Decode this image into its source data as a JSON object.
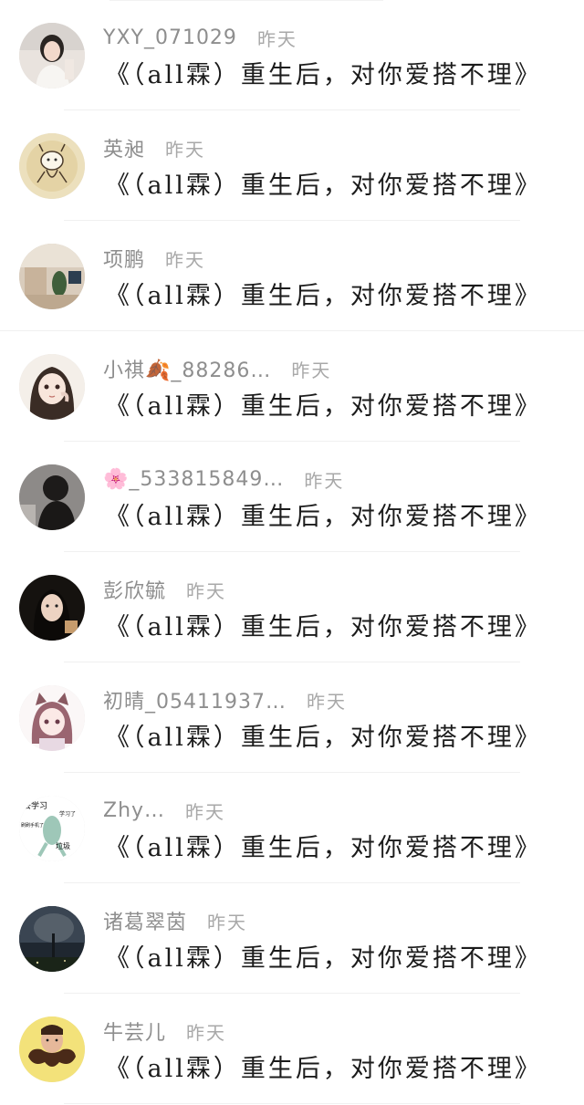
{
  "comments": [
    {
      "name": "YXY_071029",
      "time": "昨天",
      "title": "《（all霖）重生后，对你爱搭不理》",
      "avatar": "avatar-girl-photo"
    },
    {
      "name": "英昶",
      "time": "昨天",
      "title": "《（all霖）重生后，对你爱搭不理》",
      "avatar": "avatar-cartoon-creature"
    },
    {
      "name": "项鹏",
      "time": "昨天",
      "title": "《（all霖）重生后，对你爱搭不理》",
      "avatar": "avatar-room-photo"
    },
    {
      "name": "小祺🍂_88286…",
      "time": "昨天",
      "title": "《（all霖）重生后，对你爱搭不理》",
      "avatar": "avatar-anime-girl"
    },
    {
      "name": "🌸_533815849…",
      "time": "昨天",
      "title": "《（all霖）重生后，对你爱搭不理》",
      "avatar": "avatar-dark-silhouette"
    },
    {
      "name": "彭欣毓",
      "time": "昨天",
      "title": "《（all霖）重生后，对你爱搭不理》",
      "avatar": "avatar-girl-dark-photo"
    },
    {
      "name": "初晴_05411937…",
      "time": "昨天",
      "title": "《（all霖）重生后，对你爱搭不理》",
      "avatar": "avatar-catgirl-anime"
    },
    {
      "name": "Zhy…",
      "time": "昨天",
      "title": "《（all霖）重生后，对你爱搭不理》",
      "avatar": "avatar-meme-squidward"
    },
    {
      "name": "诸葛翠茵",
      "time": "昨天",
      "title": "《（all霖）重生后，对你爱搭不理》",
      "avatar": "avatar-night-tree"
    },
    {
      "name": "牛芸儿",
      "time": "昨天",
      "title": "《（all霖）重生后，对你爱搭不理》",
      "avatar": "avatar-bearded-man"
    }
  ],
  "avatar_meme_text": {
    "line1": "去学习",
    "line2": "学习了",
    "line3": "刷刷手机了",
    "line4": "垃圾"
  }
}
